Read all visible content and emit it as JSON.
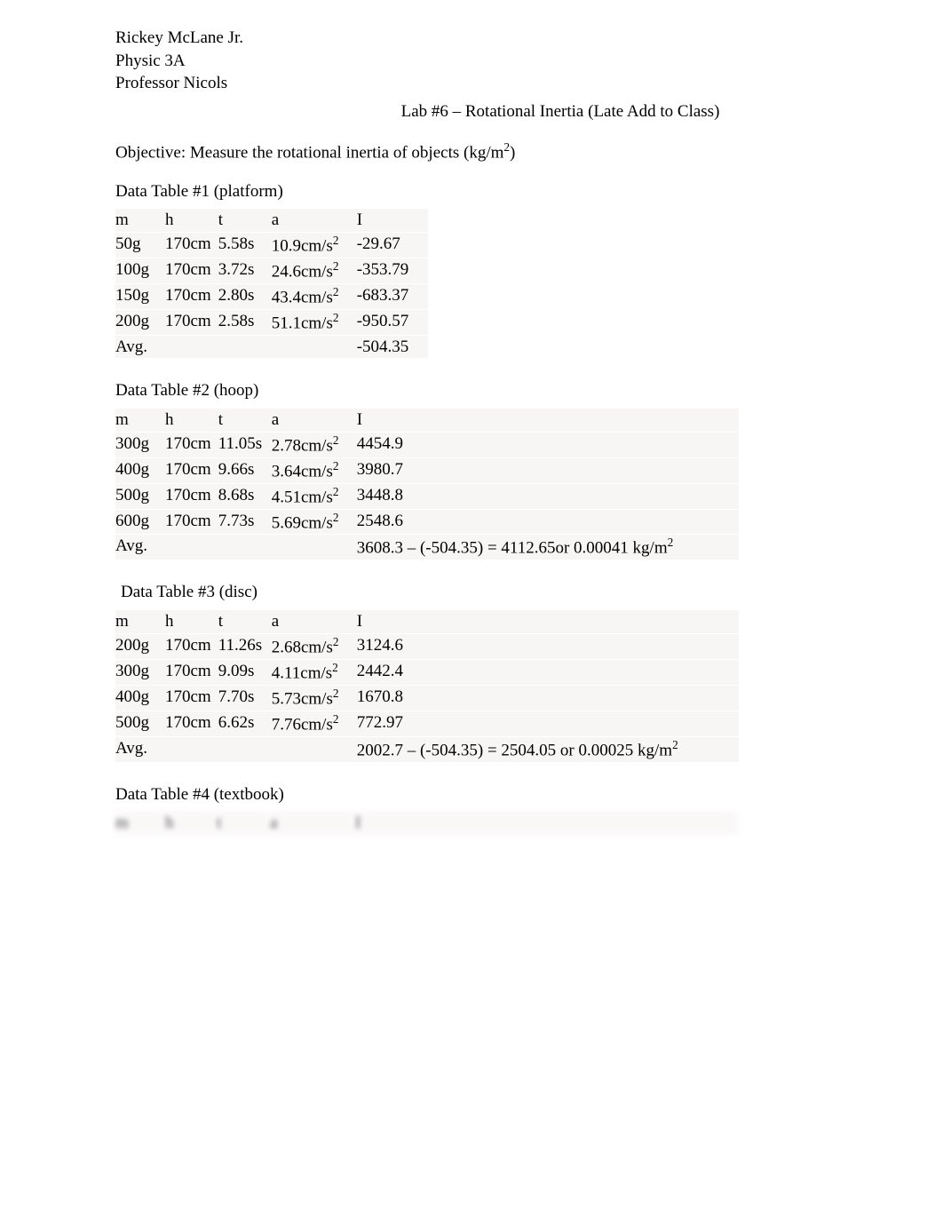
{
  "header": {
    "name": "Rickey McLane Jr.",
    "course": "Physic 3A",
    "professor": "Professor Nicols",
    "lab_title": "Lab #6 – Rotational Inertia (Late Add to Class)"
  },
  "objective_prefix": "Objective: Measure the rotational inertia of objects (kg/m",
  "objective_suffix": ")",
  "objective_exp": "2",
  "t1": {
    "label": "Data Table #1 (platform)",
    "head": {
      "m": "m",
      "h": "h",
      "t": "t",
      "a": "a",
      "I": "I"
    },
    "rows": [
      {
        "m": "50g",
        "h": "170cm",
        "t": "5.58s",
        "a": "10.9cm/s",
        "ae": "2",
        "I": "-29.67"
      },
      {
        "m": "100g",
        "h": "170cm",
        "t": "3.72s",
        "a": "24.6cm/s",
        "ae": "2",
        "I": "-353.79"
      },
      {
        "m": "150g",
        "h": "170cm",
        "t": "2.80s",
        "a": "43.4cm/s",
        "ae": "2",
        "I": "-683.37"
      },
      {
        "m": "200g",
        "h": "170cm",
        "t": "2.58s",
        "a": "51.1cm/s",
        "ae": "2",
        "I": "-950.57"
      }
    ],
    "avg_label": "Avg.",
    "avg_I": "-504.35"
  },
  "t2": {
    "label": "Data Table #2 (hoop)",
    "head": {
      "m": "m",
      "h": "h",
      "t": "t",
      "a": "a",
      "I": "I"
    },
    "rows": [
      {
        "m": "300g",
        "h": "170cm",
        "t": "11.05s",
        "a": "2.78cm/s",
        "ae": "2",
        "I": "4454.9"
      },
      {
        "m": "400g",
        "h": "170cm",
        "t": "9.66s",
        "a": "3.64cm/s",
        "ae": "2",
        "I": "3980.7"
      },
      {
        "m": "500g",
        "h": "170cm",
        "t": "8.68s",
        "a": "4.51cm/s",
        "ae": "2",
        "I": "3448.8"
      },
      {
        "m": "600g",
        "h": "170cm",
        "t": "7.73s",
        "a": "5.69cm/s",
        "ae": "2",
        "I": "2548.6"
      }
    ],
    "avg_label": "Avg.",
    "avg_I_prefix": "3608.3 – (-504.35) = 4112.65or 0.00041 kg/m",
    "avg_I_exp": "2"
  },
  "t3": {
    "label": "Data Table #3 (disc)",
    "head": {
      "m": "m",
      "h": "h",
      "t": "t",
      "a": "a",
      "I": "I"
    },
    "rows": [
      {
        "m": "200g",
        "h": "170cm",
        "t": "11.26s",
        "a": "2.68cm/s",
        "ae": "2",
        "I": "3124.6"
      },
      {
        "m": "300g",
        "h": "170cm",
        "t": "9.09s",
        "a": "4.11cm/s",
        "ae": "2",
        "I": "2442.4"
      },
      {
        "m": "400g",
        "h": "170cm",
        "t": "7.70s",
        "a": "5.73cm/s",
        "ae": "2",
        "I": "1670.8"
      },
      {
        "m": "500g",
        "h": "170cm",
        "t": "6.62s",
        "a": "7.76cm/s",
        "ae": "2",
        "I": "772.97"
      }
    ],
    "avg_label": "Avg.",
    "avg_I_prefix": "2002.7 – (-504.35) = 2504.05 or 0.00025 kg/m",
    "avg_I_exp": "2"
  },
  "t4": {
    "label": "Data Table #4 (textbook)",
    "head": {
      "m": "m",
      "h": "h",
      "t": "t",
      "a": "a",
      "I": "I"
    }
  }
}
